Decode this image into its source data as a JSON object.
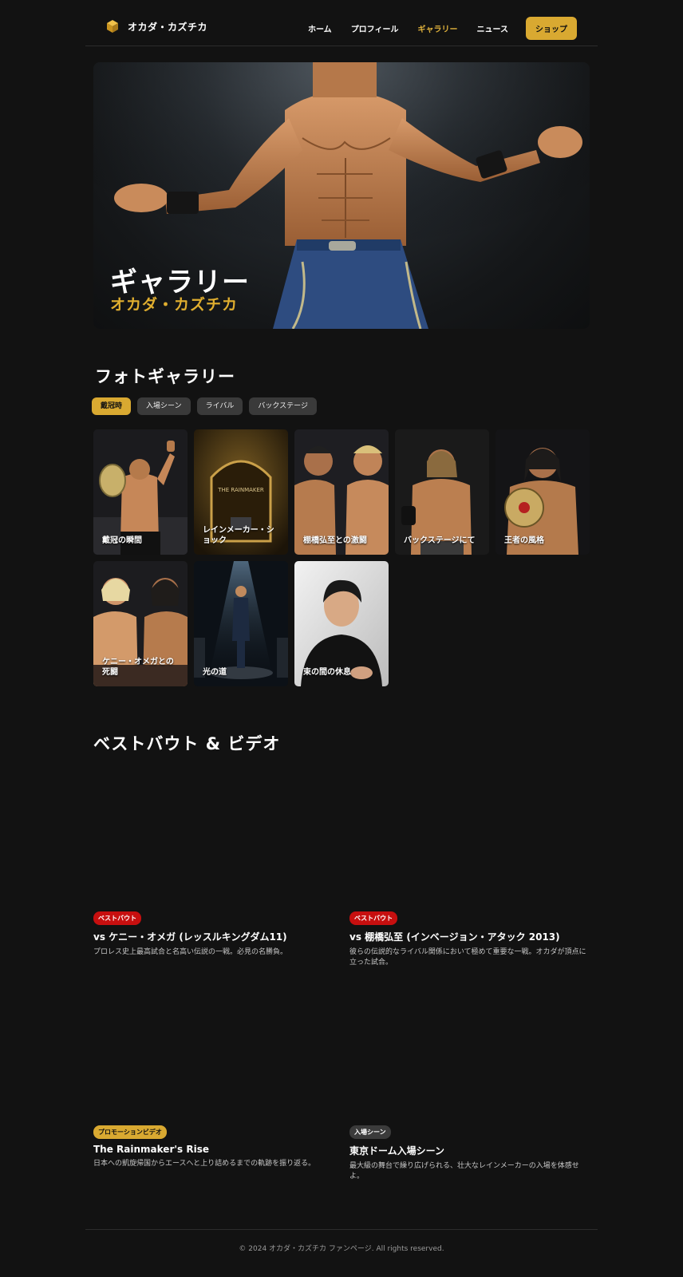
{
  "header": {
    "brand": "オカダ・カズチカ",
    "nav": [
      "ホーム",
      "プロフィール",
      "ギャラリー",
      "ニュース"
    ],
    "shop": "ショップ",
    "accent": "#d9a931"
  },
  "hero": {
    "title": "ギャラリー",
    "subtitle": "オカダ・カズチカ"
  },
  "gallery": {
    "title": "フォトギャラリー",
    "filters": [
      "戴冠時",
      "入場シーン",
      "ライバル",
      "バックステージ"
    ],
    "items": [
      "戴冠の瞬間",
      "レインメーカー・ショック",
      "棚橋弘至との激闘",
      "バックステージにて",
      "王者の風格",
      "ケニー・オメガとの死闘",
      "光の道",
      "束の間の休息"
    ],
    "sign_text": "THE RAINMAKER"
  },
  "videos": {
    "title": "ベストバウト & ビデオ",
    "items": [
      {
        "badge": "ベストバウト",
        "title": "vs ケニー・オメガ (レッスルキングダム11)",
        "desc": "プロレス史上最高試合と名高い伝説の一戦。必見の名勝負。"
      },
      {
        "badge": "ベストバウト",
        "title": "vs 棚橋弘至 (インベージョン・アタック 2013)",
        "desc": "彼らの伝説的なライバル関係において極めて重要な一戦。オカダが頂点に立った試合。"
      },
      {
        "badge": "プロモーションビデオ",
        "title": "The Rainmaker's Rise",
        "desc": "日本への凱旋帰国からエースへと上り詰めるまでの軌跡を振り返る。"
      },
      {
        "badge": "入場シーン",
        "title": "東京ドーム入場シーン",
        "desc": "最大級の舞台で繰り広げられる、壮大なレインメーカーの入場を体感せよ。"
      }
    ]
  },
  "footer": {
    "copyright": "© 2024 オカダ・カズチカ ファンページ. All rights reserved."
  }
}
